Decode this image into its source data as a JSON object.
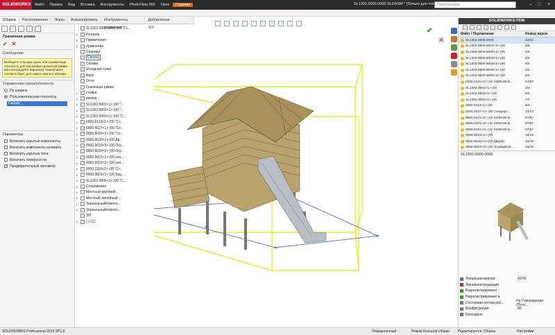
{
  "title_bar": {
    "logo": "SOLIDWORKS",
    "menus": [
      "Файл",
      "Правка",
      "Вид",
      "Вставка",
      "Инструменты",
      "PhotoView 360",
      "Окно",
      "Справка"
    ],
    "active_menu": "Справка",
    "document_title": "SL1302.0000.0000.SLDASM * [Только для чтения]",
    "search_placeholder": "Поиск команд"
  },
  "command_tabs": [
    "Сборка",
    "Расположение",
    "Эскиз",
    "Анализировать",
    "Инструменты отрисовки",
    "Добавления SOLIDWORKS"
  ],
  "property_manager": {
    "title": "Граничная рамка",
    "message_header": "Сообщение",
    "message": "Выберите плоскую грань или справочную плоскость для настройки граничной рамки или используйте параметр \"Наилучшее соответствие\" для самого малого объема.",
    "ref_header": "Справочная грань/плоскость",
    "radio_best": "По ширине",
    "radio_custom": "Пользовательская плоскость",
    "selected_plane": "Сверху",
    "options_header": "Параметры",
    "options": [
      {
        "label": "Включить скрытые компоненты",
        "checked": false
      },
      {
        "label": "Включить компоненты конверта",
        "checked": false
      },
      {
        "label": "Включить скрытые тела",
        "checked": false
      },
      {
        "label": "Включить поверхности",
        "checked": false
      },
      {
        "label": "Предварительный просмотр",
        "checked": true
      }
    ]
  },
  "feature_tree": [
    {
      "label": "SL1302.0000.0000 (00 \"Ст...",
      "expander": ""
    },
    {
      "label": "История",
      "expander": "▸"
    },
    {
      "label": "Примечания",
      "expander": "▸"
    },
    {
      "label": "Уравнения",
      "expander": "▸"
    },
    {
      "label": "Спереди",
      "expander": ""
    },
    {
      "label": "Сверху",
      "expander": "",
      "highlight": true
    },
    {
      "label": "Справа",
      "expander": ""
    },
    {
      "label": "Исходная точка",
      "expander": ""
    },
    {
      "label": "Верх",
      "expander": ""
    },
    {
      "label": "Отоп",
      "expander": ""
    },
    {
      "label": "Граничная рамка",
      "expander": ""
    },
    {
      "label": "стойки",
      "expander": "▸"
    },
    {
      "label": "вкопки",
      "expander": "▸"
    },
    {
      "label": "SL1302.0001<1> (00 \"...",
      "expander": "▸"
    },
    {
      "label": "SL1302.0002<1> (00 \"...",
      "expander": "▸"
    },
    {
      "label": "SL1302.0003<1> (00 \"С...",
      "expander": "▸"
    },
    {
      "label": "0000.6113<1> (00 \"Ст...",
      "expander": "▸"
    },
    {
      "label": "0000.4027<1> (00 \"Ст...",
      "expander": "▸"
    },
    {
      "label": "0000.9019<1> (00 \"Ст...",
      "expander": "▸"
    },
    {
      "label": "0000.9020<1> (00 Дв...",
      "expander": "▸"
    },
    {
      "label": "0000.9019<3> (00 Огр...",
      "expander": "▸"
    },
    {
      "label": "0000.9020<2> (00 Огр...",
      "expander": "▸"
    },
    {
      "label": "0000.9021<1> (00 нач...",
      "expander": "▸"
    },
    {
      "label": "0000.9021<2> (00 нач...",
      "expander": "▸"
    },
    {
      "label": "0000.1118<2> (00 \"Ст...",
      "expander": "▸"
    },
    {
      "label": "0000.9021<1> (00 Зац...",
      "expander": "▸"
    },
    {
      "label": "SL1301.0006<1> (00 \"С...",
      "expander": "▸"
    },
    {
      "label": "Сопряжения",
      "expander": "▸"
    },
    {
      "label": "Местный круговой ...",
      "expander": "▸"
    },
    {
      "label": "Местный линейный ...",
      "expander": "▸"
    },
    {
      "label": "ЗеркальныйКомпон...",
      "expander": "▸"
    },
    {
      "label": "ЗеркальныйКомпон...",
      "expander": "▸"
    },
    {
      "label": "ЭП",
      "expander": ""
    },
    {
      "label": "(-) СС",
      "expander": "▸"
    }
  ],
  "pdm": {
    "header": "SOLIDWORKS PDM",
    "col_name": "Файл / Переменная",
    "col_version": "Номер верси",
    "rows": [
      {
        "name": "SL1302.0000.0000",
        "version": "42/42",
        "sel": true
      },
      {
        "name": "SL1302.0000.5001<1> (00",
        "version": "6/6"
      },
      {
        "name": "SL1302.0000.5002<1> (00",
        "version": "5/5"
      },
      {
        "name": "SL1302.0000.5003<1> (00",
        "version": "5/5"
      },
      {
        "name": "SL1302.0000.5004<1> (00",
        "version": "5/5"
      },
      {
        "name": "SL1302.0000.5006<1> (00",
        "version": "4/4"
      },
      {
        "name": "SL1302.0000.5005<3> (00",
        "version": "5/5"
      },
      {
        "name": "0000.2101<1> (12 SO08.80 Б...",
        "version": "87/87"
      },
      {
        "name": "SL1302.0001<1> (00",
        "version": "3/3"
      },
      {
        "name": "SL1302.0002<1> (00",
        "version": "5/5"
      },
      {
        "name": "SL1302.0003<1> (00",
        "version": "7/7"
      },
      {
        "name": "0000.6113<1> (00",
        "version": "6/6"
      },
      {
        "name": "0000.4027<1> (00 стандарт...",
        "version": "13/13"
      },
      {
        "name": "0000.2101<2> (12 SO08.80 Б...",
        "version": "87/87"
      },
      {
        "name": "0000.2101<3> (12 SO08.80 Б...",
        "version": "87/87"
      },
      {
        "name": "0000.2101<4> (12 SO08.80 Б...",
        "version": "87/87"
      },
      {
        "name": "0000.9019<1> (00",
        "version": "19/19"
      },
      {
        "name": "0000.9020<1> (00 Двери)",
        "version": "19/19"
      },
      {
        "name": "0000.9019<3> (02 Ограждени...",
        "version": "19/19"
      }
    ],
    "preview_label": "SL1302.0000.0000",
    "properties": [
      {
        "label": "Локальная версия",
        "value": "42/42",
        "color": "#5577aa"
      },
      {
        "label": "Локальная редакция",
        "value": "",
        "color": "#c62828"
      },
      {
        "label": "Разрегистрировано",
        "value": "",
        "color": "#2a9a2a"
      },
      {
        "label": "Разрегистрировано в",
        "value": "",
        "color": "#2a9a2a"
      },
      {
        "label": "Состояние потока раб...",
        "value": "На Утверждении (Пото...",
        "color": "#777777"
      },
      {
        "label": "Конфигурация",
        "value": "00",
        "color": "#777777"
      },
      {
        "label": "Description",
        "value": "",
        "color": "#5577aa"
      }
    ]
  },
  "status_bar": {
    "left": "SOLIDWORKS Professional 2019 SP1.0",
    "items": [
      "Определенный",
      "Режим большой сборки",
      "Редактируется: Сборка",
      "Настройки"
    ]
  },
  "colors": {
    "accent": "#cf6a1a",
    "brand": "#c8102e",
    "bounding_box": "#f2f200",
    "model": "#b5a06a"
  }
}
